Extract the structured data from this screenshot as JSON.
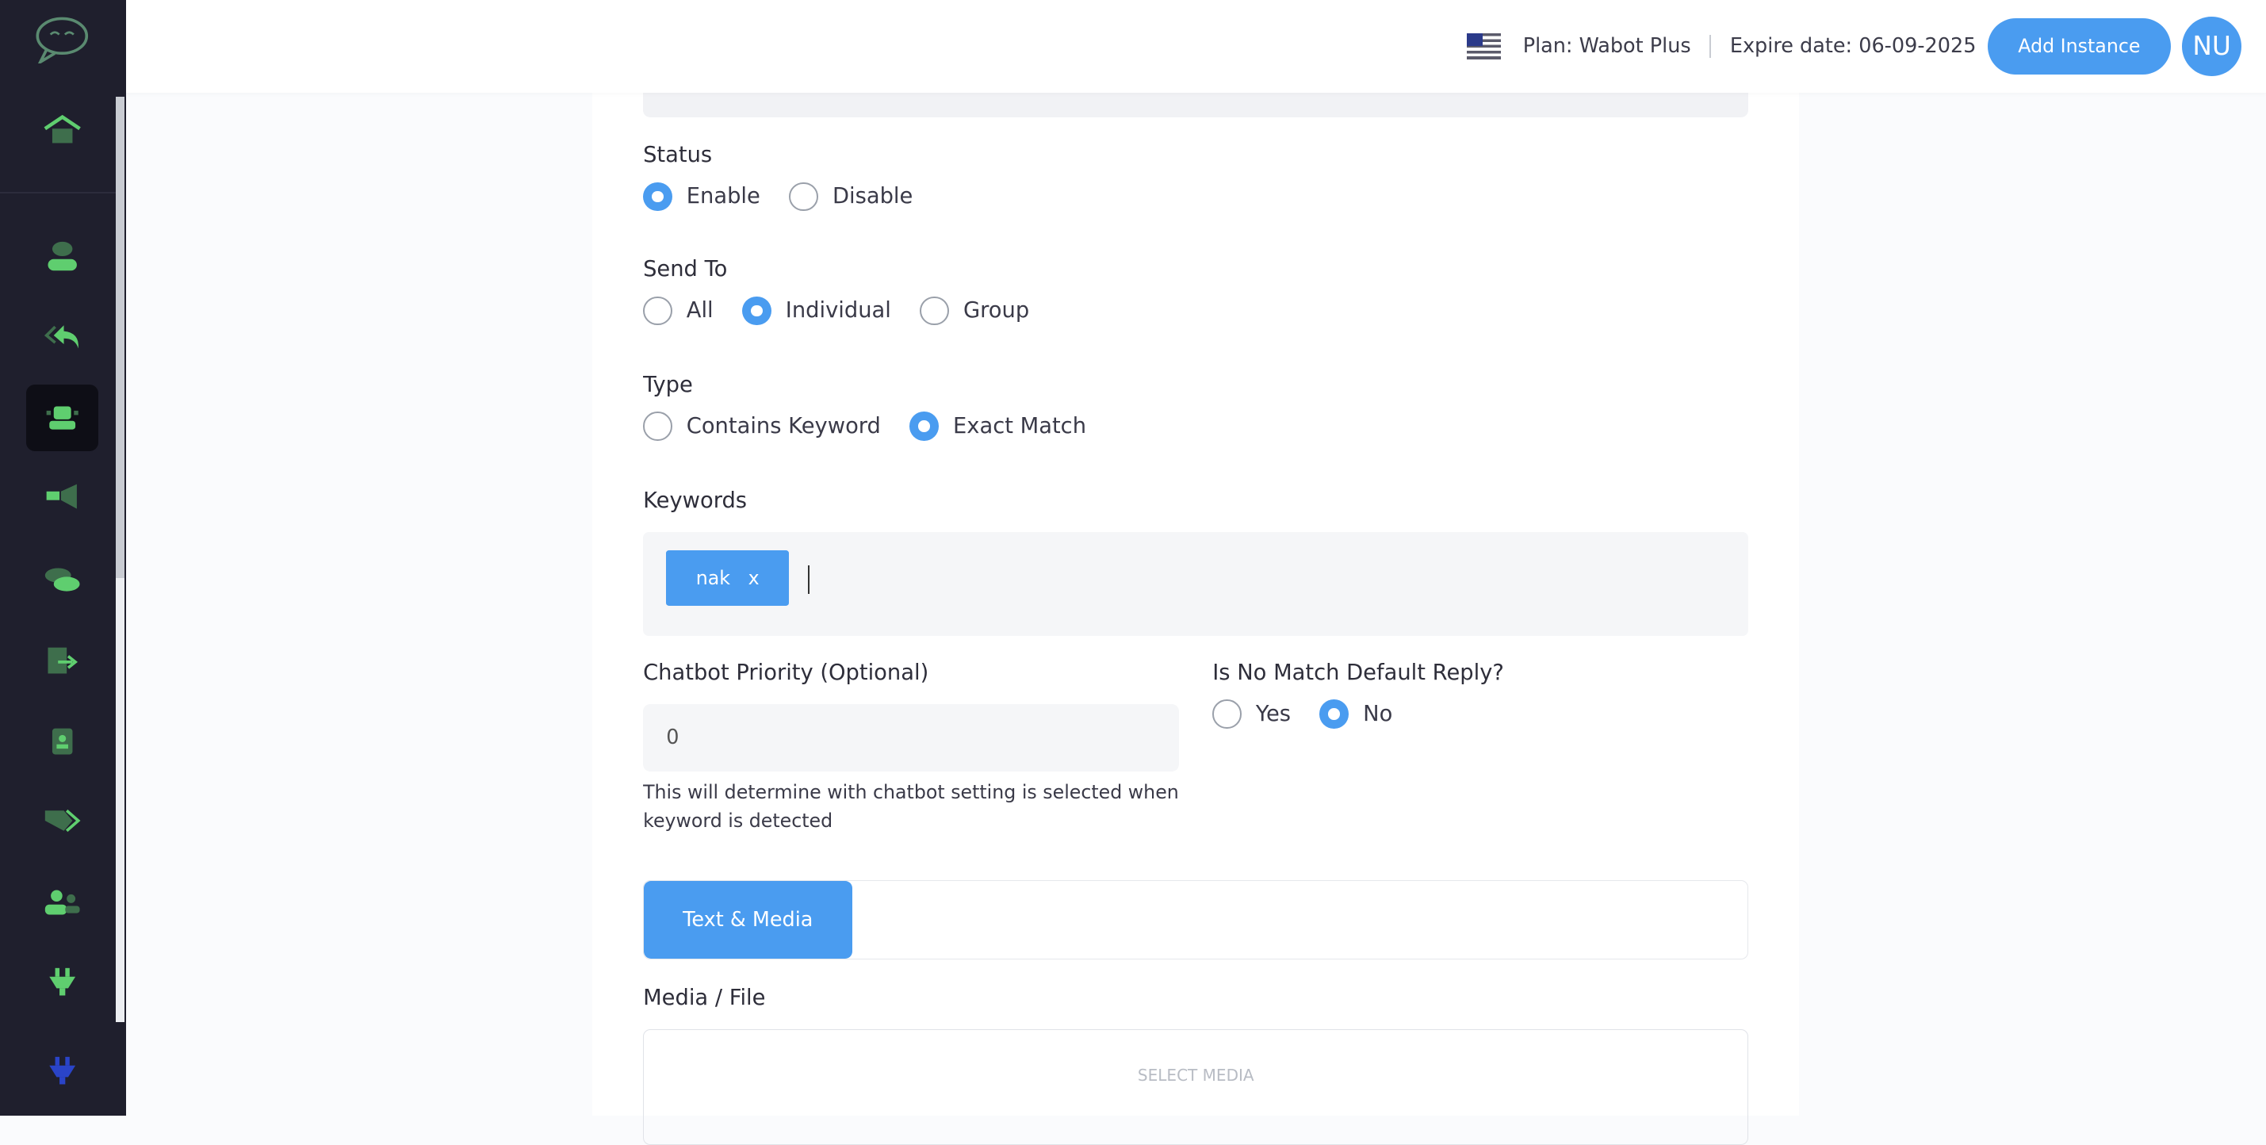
{
  "header": {
    "plan": "Plan: Wabot Plus",
    "expire": "Expire date: 06-09-2025",
    "add_instance": "Add Instance",
    "avatar": "NU"
  },
  "sidebar": {
    "items": [
      "home-icon",
      "user-icon",
      "reply-icon",
      "robot-icon",
      "megaphone-icon",
      "chat-icon",
      "file-export-icon",
      "contact-book-icon",
      "tags-icon",
      "users-icon",
      "plug-icon",
      "plug-icon"
    ],
    "active": "robot-icon",
    "colors": {
      "bg": "#1f1f2d",
      "icon": "#5fce6f",
      "icon_dark": "#3e6e4c"
    }
  },
  "form": {
    "status": {
      "label": "Status",
      "options": [
        "Enable",
        "Disable"
      ],
      "selected": "Enable"
    },
    "send_to": {
      "label": "Send To",
      "options": [
        "All",
        "Individual",
        "Group"
      ],
      "selected": "Individual"
    },
    "type": {
      "label": "Type",
      "options": [
        "Contains Keyword",
        "Exact Match"
      ],
      "selected": "Exact Match"
    },
    "keywords": {
      "label": "Keywords",
      "tags": [
        "nak"
      ],
      "remove": "x"
    },
    "priority": {
      "label": "Chatbot Priority (Optional)",
      "value": "0",
      "help": "This will determine with chatbot setting is selected when keyword is detected"
    },
    "no_match": {
      "label": "Is No Match Default Reply?",
      "options": [
        "Yes",
        "No"
      ],
      "selected": "No"
    },
    "tabs": [
      "Text & Media"
    ],
    "media": {
      "label": "Media / File",
      "button": "SELECT MEDIA"
    }
  },
  "accent": "#4a9cf0"
}
